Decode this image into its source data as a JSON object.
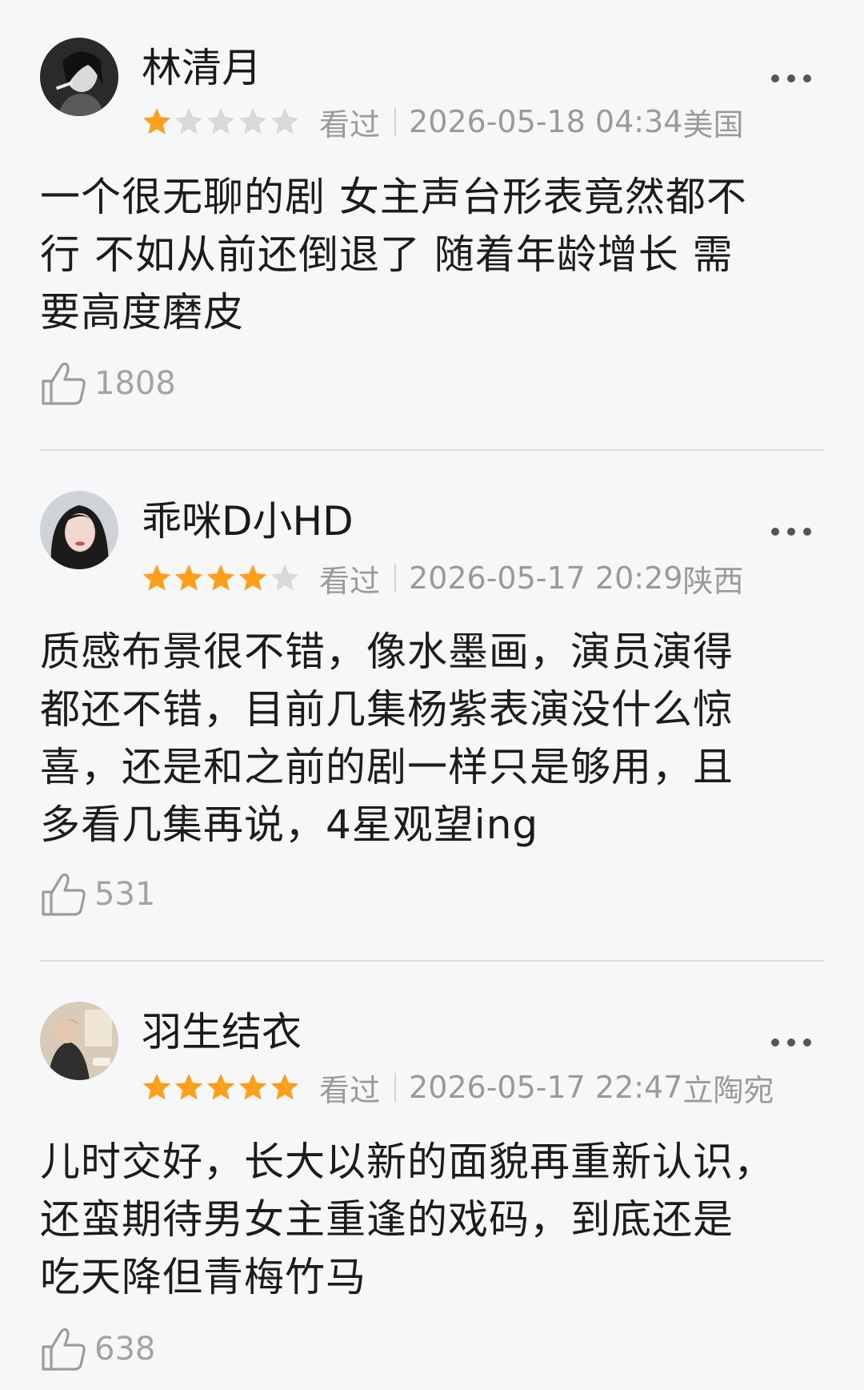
{
  "reviews": [
    {
      "username": "林清月",
      "rating": 1,
      "watched": "看过",
      "datetime": "2026-05-18 04:34",
      "location": "美国",
      "lines": [
        "一个很无聊的剧 女主声台形表竟然都不",
        "行 不如从前还倒退了 随着年龄增长  需",
        "要高度磨皮"
      ],
      "likes": "1808"
    },
    {
      "username": "乖咪D小HD",
      "rating": 4,
      "watched": "看过",
      "datetime": "2026-05-17 20:29",
      "location": "陕西",
      "lines": [
        "质感布景很不错，像水墨画，演员演得",
        "都还不错，目前几集杨紫表演没什么惊",
        "喜，还是和之前的剧一样只是够用，且",
        "多看几集再说，4星观望ing"
      ],
      "likes": "531"
    },
    {
      "username": "羽生结衣",
      "rating": 5,
      "watched": "看过",
      "datetime": "2026-05-17 22:47",
      "location": "立陶宛",
      "lines": [
        "儿时交好，长大以新的面貌再重新认识，",
        "还蛮期待男女主重逢的戏码，到底还是",
        "吃天降但青梅竹马"
      ],
      "likes": "638"
    }
  ],
  "colors": {
    "star_filled": "#ff9f1a",
    "star_empty": "#d9d9d9",
    "meta_text": "#9a9a9a",
    "background": "#f6f7f9"
  },
  "icons": {
    "like": "thumbs-up-icon",
    "more": "more-dots-icon",
    "star": "star-icon"
  }
}
